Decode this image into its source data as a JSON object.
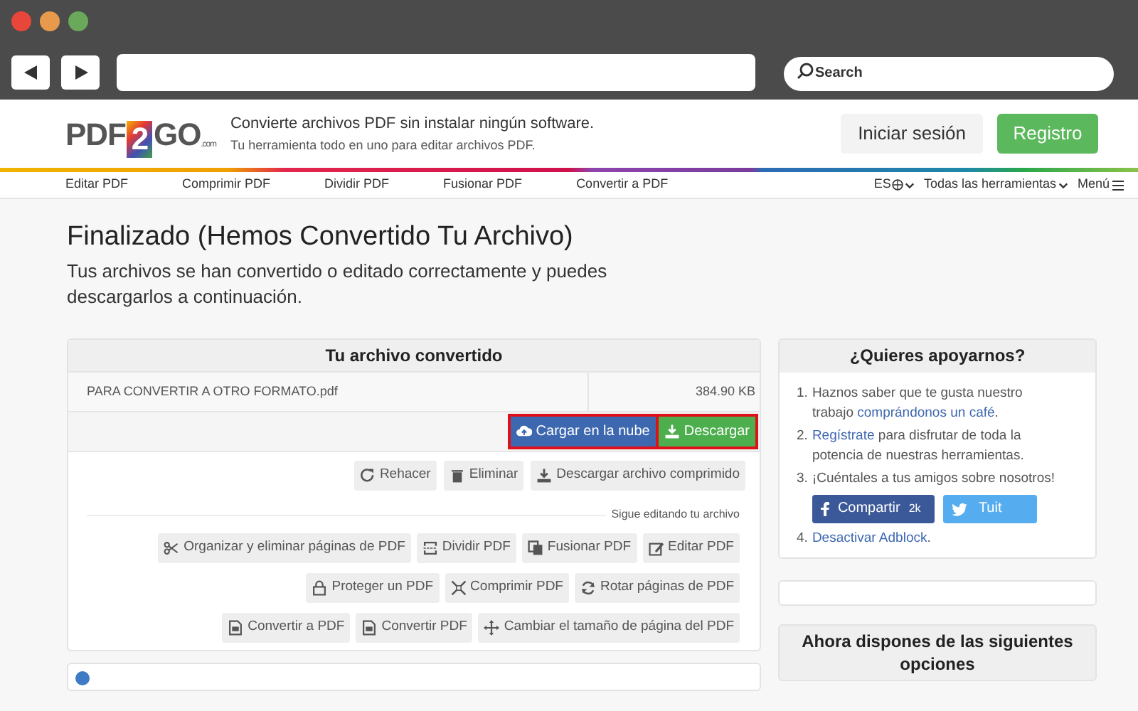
{
  "browser": {
    "search_placeholder": "Search"
  },
  "header": {
    "logo": {
      "left": "PDF",
      "middle": "2",
      "right": "GO",
      "small": ".com"
    },
    "tagline": "Convierte archivos PDF sin instalar ningún software.",
    "subtagline": "Tu herramienta todo en uno para editar archivos PDF.",
    "login": "Iniciar sesión",
    "register": "Registro"
  },
  "nav": {
    "items": [
      "Editar PDF",
      "Comprimir PDF",
      "Dividir PDF",
      "Fusionar PDF",
      "Convertir a PDF"
    ],
    "language": "ES",
    "all_tools": "Todas las herramientas",
    "menu": "Menú"
  },
  "title": "Finalizado (Hemos Convertido Tu Archivo)",
  "subtitle": "Tus archivos se han convertido o editado correctamente y puedes descargarlos a continuación.",
  "file_card": {
    "heading": "Tu archivo convertido",
    "file_name": "PARA CONVERTIR A OTRO FORMATO.pdf",
    "file_size": "384.90 KB",
    "primary_actions": [
      {
        "label": "Cargar en la nube",
        "kind": "cloud",
        "highlighted": true
      },
      {
        "label": "Descargar",
        "kind": "download",
        "highlighted": true
      }
    ],
    "secondary_actions": [
      {
        "label": "Rehacer",
        "kind": "redo"
      },
      {
        "label": "Eliminar",
        "kind": "trash"
      },
      {
        "label": "Descargar archivo comprimido",
        "kind": "download"
      }
    ],
    "continue_label": "Sigue editando tu archivo",
    "tool_rows": [
      [
        {
          "label": "Organizar y eliminar páginas de PDF",
          "kind": "scissors"
        },
        {
          "label": "Dividir PDF",
          "kind": "split"
        },
        {
          "label": "Fusionar PDF",
          "kind": "copy"
        },
        {
          "label": "Editar PDF",
          "kind": "edit"
        }
      ],
      [
        {
          "label": "Proteger un PDF",
          "kind": "lock"
        },
        {
          "label": "Comprimir PDF",
          "kind": "compress"
        },
        {
          "label": "Rotar páginas de PDF",
          "kind": "rotate"
        }
      ],
      [
        {
          "label": "Convertir a PDF",
          "kind": "file"
        },
        {
          "label": "Convertir PDF",
          "kind": "file"
        },
        {
          "label": "Cambiar el tamaño de página del PDF",
          "kind": "move"
        }
      ]
    ]
  },
  "support_card": {
    "heading": "¿Quieres apoyarnos?",
    "items": [
      {
        "number": "1.",
        "text": "Haznos saber que te gusta nuestro trabajo ",
        "link": "comprándonos un café",
        "after": "."
      },
      {
        "number": "2.",
        "link": "Regístrate",
        "text": " para disfrutar de toda la potencia de nuestras herramientas."
      },
      {
        "number": "3.",
        "text": "¡Cuéntales a tus amigos sobre nosotros!",
        "share": {
          "facebook": "Compartir",
          "count": "2k",
          "twitter": "Tuit"
        }
      },
      {
        "number": "4.",
        "link": "Desactivar Adblock",
        "after": "."
      }
    ]
  },
  "options_card": {
    "heading": "Ahora dispones de las siguientes opciones"
  }
}
